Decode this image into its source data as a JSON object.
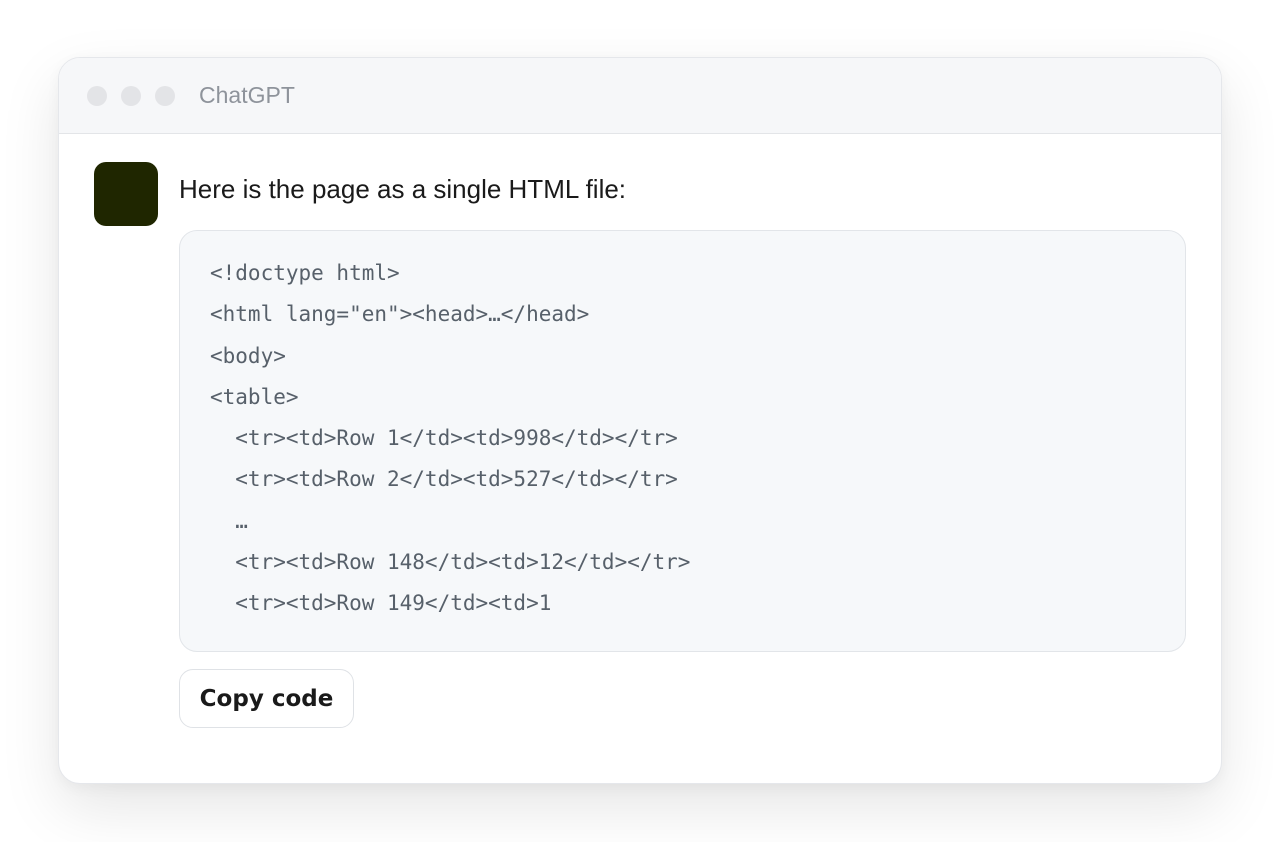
{
  "window": {
    "title": "ChatGPT"
  },
  "message": {
    "text": "Here is the page as a single HTML file:"
  },
  "code": {
    "lines": [
      "<!doctype html>",
      "<html lang=\"en\"><head>…</head>",
      "<body>",
      "<table>",
      "  <tr><td>Row 1</td><td>998</td></tr>",
      "  <tr><td>Row 2</td><td>527</td></tr>",
      "  …",
      "  <tr><td>Row 148</td><td>12</td></tr>",
      "  <tr><td>Row 149</td><td>1"
    ]
  },
  "actions": {
    "copy_label": "Copy code"
  },
  "colors": {
    "avatar": "#1f2600",
    "code_background": "#f6f8fa",
    "code_text": "#57606a"
  }
}
